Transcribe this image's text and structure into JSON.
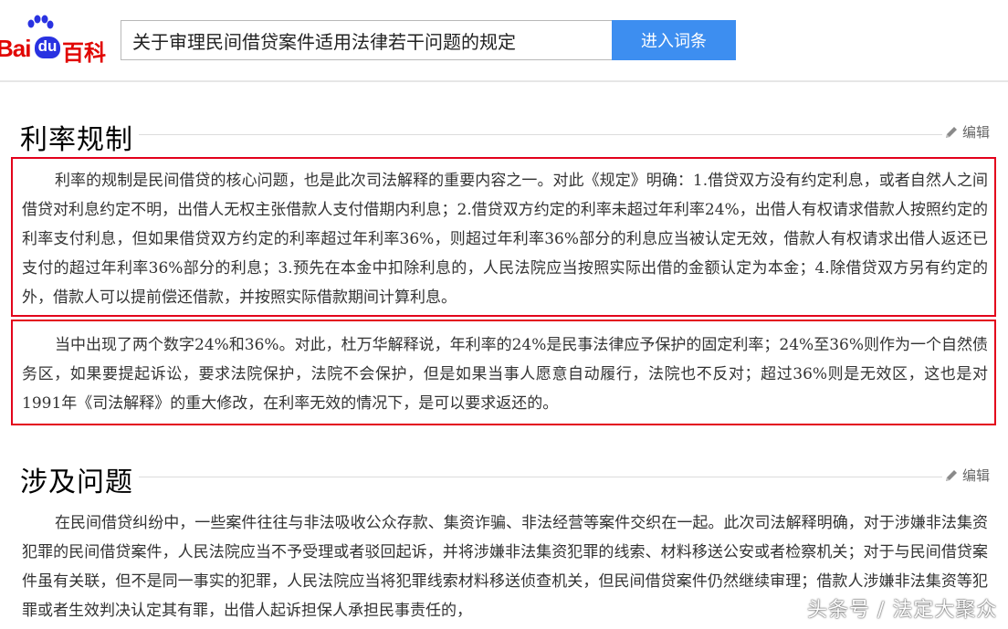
{
  "header": {
    "logo_bai": "Bai",
    "logo_du": "du",
    "logo_baike": "百科",
    "search_value": "关于审理民间借贷案件适用法律若干问题的规定",
    "search_button": "进入词条"
  },
  "sections": [
    {
      "title": "利率规制",
      "edit_label": "编辑",
      "paragraphs": [
        "利率的规制是民间借贷的核心问题，也是此次司法解释的重要内容之一。对此《规定》明确：1.借贷双方没有约定利息，或者自然人之间借贷对利息约定不明，出借人无权主张借款人支付借期内利息；2.借贷双方约定的利率未超过年利率24%，出借人有权请求借款人按照约定的利率支付利息，但如果借贷双方约定的利率超过年利率36%，则超过年利率36%部分的利息应当被认定无效，借款人有权请求出借人返还已支付的超过年利率36%部分的利息；3.预先在本金中扣除利息的，人民法院应当按照实际出借的金额认定为本金；4.除借贷双方另有约定的外，借款人可以提前偿还借款，并按照实际借款期间计算利息。",
        "当中出现了两个数字24%和36%。对此，杜万华解释说，年利率的24%是民事法律应予保护的固定利率；24%至36%则作为一个自然债务区，如果要提起诉讼，要求法院保护，法院不会保护，但是如果当事人愿意自动履行，法院也不反对；超过36%则是无效区，这也是对1991年《司法解释》的重大修改，在利率无效的情况下，是可以要求返还的。"
      ]
    },
    {
      "title": "涉及问题",
      "edit_label": "编辑",
      "paragraphs": [
        "在民间借贷纠纷中，一些案件往往与非法吸收公众存款、集资诈骗、非法经营等案件交织在一起。此次司法解释明确，对于涉嫌非法集资犯罪的民间借贷案件，人民法院应当不予受理或者驳回起诉，并将涉嫌非法集资犯罪的线索、材料移送公安或者检察机关；对于与民间借贷案件虽有关联，但不是同一事实的犯罪，人民法院应当将犯罪线索材料移送侦查机关，但民间借贷案件仍然继续审理；借款人涉嫌非法集资等犯罪或者生效判决认定其有罪，出借人起诉担保人承担民事责任的，"
      ]
    }
  ],
  "watermark": "头条号 / 法定大聚众",
  "colors": {
    "accent_red": "#e3001b",
    "search_blue": "#3d8ef0",
    "logo_red": "#e10602",
    "logo_blue": "#2932e1"
  }
}
